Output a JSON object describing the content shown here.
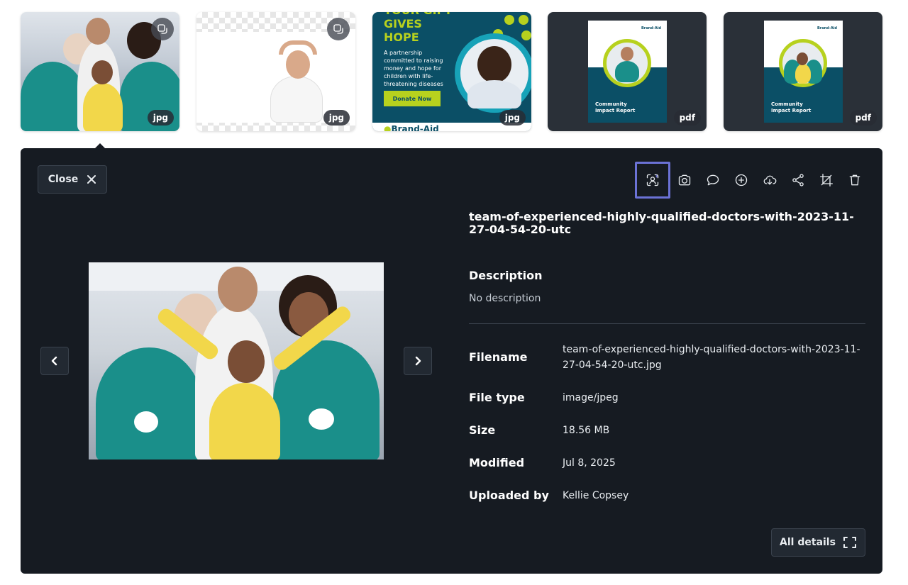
{
  "thumbnails": [
    {
      "type_badge": "jpg",
      "link_icon": "link-replace-icon"
    },
    {
      "type_badge": "jpg",
      "link_icon": "link-replace-icon"
    },
    {
      "type_badge": "jpg",
      "headline": "YOUR GIFT\nGIVES\nHOPE",
      "body": "A partnership committed to raising money and hope for children with life-threatening diseases",
      "button": "Donate Now",
      "brand": "Brand-Aid"
    },
    {
      "type_badge": "pdf",
      "poster_title": "Community\nImpact Report",
      "poster_logo": "Brand-Aid"
    },
    {
      "type_badge": "pdf",
      "poster_title": "Community\nImpact Report",
      "poster_logo": "Brand-Aid"
    }
  ],
  "panel": {
    "close_label": "Close",
    "toolbar_icons": [
      "face-recognition-icon",
      "camera-icon",
      "comment-icon",
      "add-icon",
      "cloud-download-icon",
      "share-icon",
      "crop-icon",
      "trash-icon"
    ],
    "title": "team-of-experienced-highly-qualified-doctors-with-2023-11-27-04-54-20-utc",
    "description_heading": "Description",
    "description_value": "No description",
    "details": [
      {
        "label": "Filename",
        "value": "team-of-experienced-highly-qualified-doctors-with-2023-11-27-04-54-20-utc.jpg"
      },
      {
        "label": "File type",
        "value": "image/jpeg"
      },
      {
        "label": "Size",
        "value": "18.56 MB"
      },
      {
        "label": "Modified",
        "value": "Jul 8, 2025"
      },
      {
        "label": "Uploaded by",
        "value": "Kellie Copsey"
      }
    ],
    "all_details_label": "All details"
  },
  "colors": {
    "panel_bg": "#161b22",
    "button_bg": "#222932",
    "accent_selected": "#6b72d6",
    "brand_green": "#b7d11e",
    "brand_teal": "#0b4f66"
  }
}
